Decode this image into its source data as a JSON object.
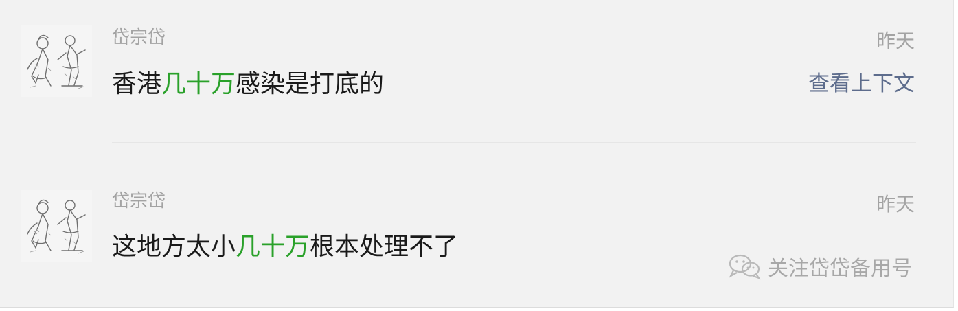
{
  "messages": [
    {
      "author": "岱宗岱",
      "time": "昨天",
      "text_before": "香港",
      "highlight": "几十万",
      "text_after": "感染是打底的",
      "context_link": "查看上下文"
    },
    {
      "author": "岱宗岱",
      "time": "昨天",
      "text_before": "这地方太小",
      "highlight": "几十万",
      "text_after": "根本处理不了"
    }
  ],
  "watermark": {
    "text": "关注岱岱备用号",
    "icon": "wechat-icon"
  },
  "colors": {
    "background": "#f2f2f2",
    "highlight": "#2aa12a",
    "meta_text": "#a3a3a3",
    "link": "#5d6c8c",
    "body_text": "#1a1a1a"
  }
}
